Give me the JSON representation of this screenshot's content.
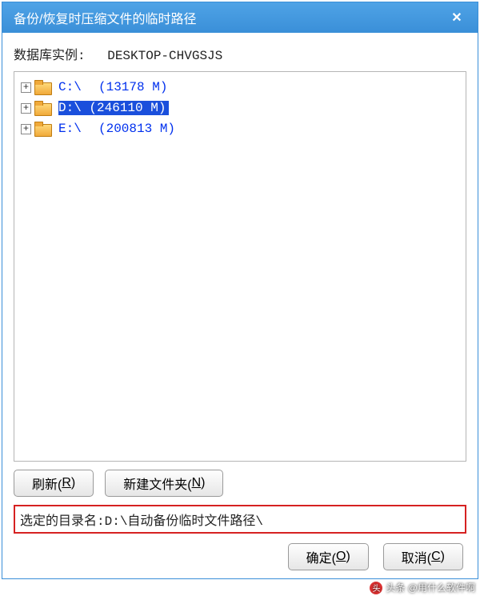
{
  "window": {
    "title": "备份/恢复时压缩文件的临时路径",
    "close_symbol": "✕"
  },
  "db_instance": {
    "label": "数据库实例:",
    "value": "DESKTOP-CHVGSJS"
  },
  "drives": [
    {
      "expander": "+",
      "name": "C:\\",
      "size": "(13178 M)",
      "selected": false
    },
    {
      "expander": "+",
      "name": "D:\\",
      "size": "(246110 M)",
      "selected": true
    },
    {
      "expander": "+",
      "name": "E:\\",
      "size": "(200813 M)",
      "selected": false
    }
  ],
  "buttons": {
    "refresh": {
      "text": "刷新(",
      "accel": "R",
      "suffix": ")"
    },
    "new_folder": {
      "text": "新建文件夹(",
      "accel": "N",
      "suffix": ")"
    },
    "ok": {
      "text": "确定(",
      "accel": "O",
      "suffix": ")"
    },
    "cancel": {
      "text": "取消(",
      "accel": "C",
      "suffix": ")"
    }
  },
  "selected_path": {
    "label": "选定的目录名:",
    "value": "D:\\自动备份临时文件路径\\"
  },
  "watermark": {
    "text": "头条 @用什么软件啊"
  }
}
